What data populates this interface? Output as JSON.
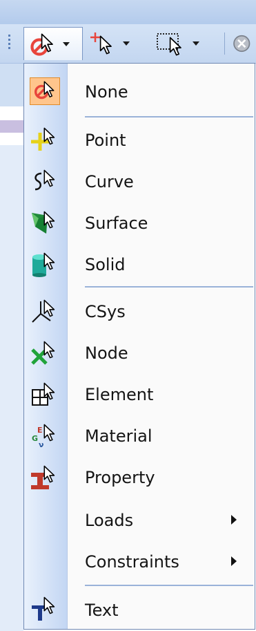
{
  "toolbar": {
    "buttons": [
      {
        "id": "select-none-dropdown",
        "icon": "select-none-icon",
        "active": true
      },
      {
        "id": "select-point-dropdown",
        "icon": "select-point-icon"
      },
      {
        "id": "select-box-dropdown",
        "icon": "select-box-icon"
      },
      {
        "id": "partial-tool",
        "icon": "clear-icon"
      }
    ]
  },
  "menu": {
    "items": [
      {
        "label": "None",
        "icon": "select-none-icon",
        "selected": true
      },
      {
        "label": "Point",
        "icon": "point-icon"
      },
      {
        "label": "Curve",
        "icon": "curve-icon"
      },
      {
        "label": "Surface",
        "icon": "surface-icon"
      },
      {
        "label": "Solid",
        "icon": "solid-icon"
      },
      {
        "label": "CSys",
        "icon": "csys-icon"
      },
      {
        "label": "Node",
        "icon": "node-icon"
      },
      {
        "label": "Element",
        "icon": "element-icon"
      },
      {
        "label": "Material",
        "icon": "material-icon"
      },
      {
        "label": "Property",
        "icon": "property-icon"
      },
      {
        "label": "Loads",
        "icon": "",
        "submenu": true
      },
      {
        "label": "Constraints",
        "icon": "",
        "submenu": true
      },
      {
        "label": "Text",
        "icon": "text-icon"
      }
    ]
  }
}
